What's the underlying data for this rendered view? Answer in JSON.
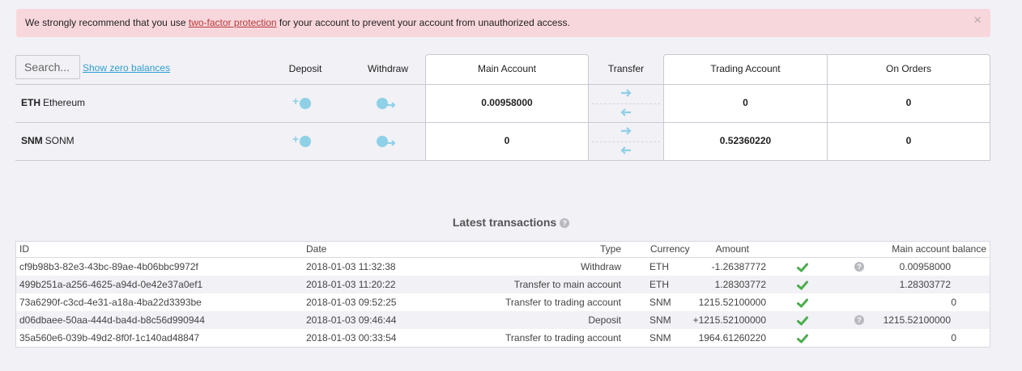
{
  "alert": {
    "prefix": "We strongly recommend that you use ",
    "link": "two-factor protection",
    "suffix": " for your account to prevent your account from unauthorized access.",
    "close": "×"
  },
  "balances": {
    "search_placeholder": "Search...",
    "show_zero": "Show zero balances",
    "headers": {
      "deposit": "Deposit",
      "withdraw": "Withdraw",
      "main": "Main Account",
      "transfer": "Transfer",
      "trading": "Trading Account",
      "orders": "On Orders"
    },
    "rows": [
      {
        "symbol": "ETH",
        "name": "Ethereum",
        "main": "0.00958000",
        "trading": "0",
        "orders": "0"
      },
      {
        "symbol": "SNM",
        "name": "SONM",
        "main": "0",
        "trading": "0.52360220",
        "orders": "0"
      }
    ]
  },
  "transactions": {
    "title": "Latest transactions",
    "help": "?",
    "headers": {
      "id": "ID",
      "date": "Date",
      "type": "Type",
      "currency": "Currency",
      "amount": "Amount",
      "balance": "Main account balance"
    },
    "rows": [
      {
        "id": "cf9b98b3-82e3-43bc-89ae-4b06bbc9972f",
        "date": "2018-01-03 11:32:38",
        "type": "Withdraw",
        "currency": "ETH",
        "amount": "-1.26387772",
        "has_help": true,
        "balance": "0.00958000"
      },
      {
        "id": "499b251a-a256-4625-a94d-0e42e37a0ef1",
        "date": "2018-01-03 11:20:22",
        "type": "Transfer to main account",
        "currency": "ETH",
        "amount": "1.28303772",
        "has_help": false,
        "balance": "1.28303772"
      },
      {
        "id": "73a6290f-c3cd-4e31-a18a-4ba22d3393be",
        "date": "2018-01-03 09:52:25",
        "type": "Transfer to trading account",
        "currency": "SNM",
        "amount": "1215.52100000",
        "has_help": false,
        "balance": "0"
      },
      {
        "id": "d06dbaee-50aa-444d-ba4d-b8c56d990944",
        "date": "2018-01-03 09:46:44",
        "type": "Deposit",
        "currency": "SNM",
        "amount": "+1215.52100000",
        "has_help": true,
        "balance": "1215.52100000"
      },
      {
        "id": "35a560e6-039b-49d2-8f0f-1c140ad48847",
        "date": "2018-01-03 00:33:54",
        "type": "Transfer to trading account",
        "currency": "SNM",
        "amount": "1964.61260220",
        "has_help": false,
        "balance": "0"
      }
    ]
  },
  "colors": {
    "accent": "#8fd0e6",
    "success": "#4cae4c",
    "alert_bg": "#f8d7dc",
    "link": "#2f9fd0"
  }
}
